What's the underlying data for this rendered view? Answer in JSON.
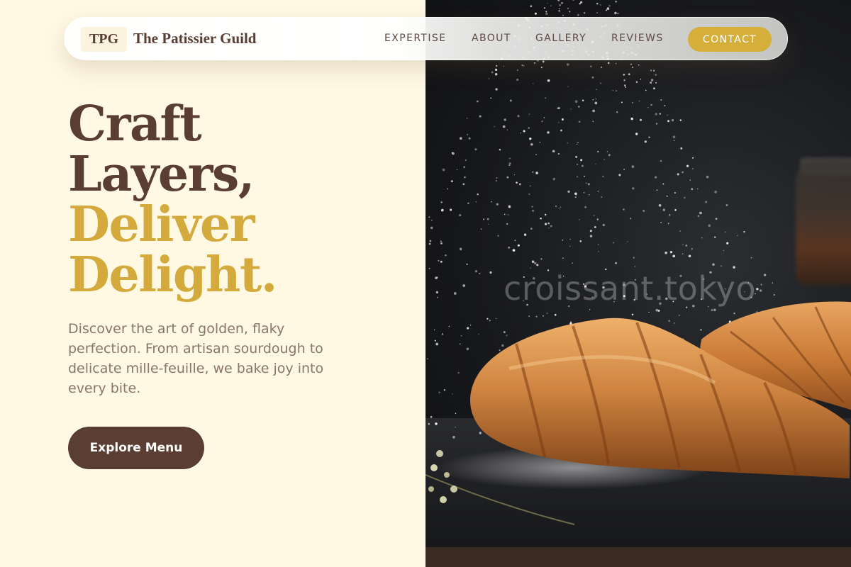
{
  "nav": {
    "logo_mark": "TPG",
    "brand_name": "The Patissier Guild",
    "links": [
      {
        "label": "EXPERTISE"
      },
      {
        "label": "ABOUT"
      },
      {
        "label": "GALLERY"
      },
      {
        "label": "REVIEWS"
      }
    ],
    "contact_label": "CONTACT"
  },
  "hero": {
    "headline_line1": "Craft",
    "headline_line2": "Layers,",
    "headline_line3": "Deliver",
    "headline_line4": "Delight.",
    "description": "Discover the art of golden, flaky perfection. From artisan sourdough to delicate mille-feuille, we bake joy into every bite.",
    "cta_label": "Explore Menu"
  },
  "image": {
    "watermark": "croissant.tokyo"
  },
  "colors": {
    "background_cream": "#fff8e3",
    "brown": "#5a3e34",
    "gold": "#d4aa3c",
    "contact_gold": "#d6ae3a",
    "body_text": "#8a766c"
  }
}
